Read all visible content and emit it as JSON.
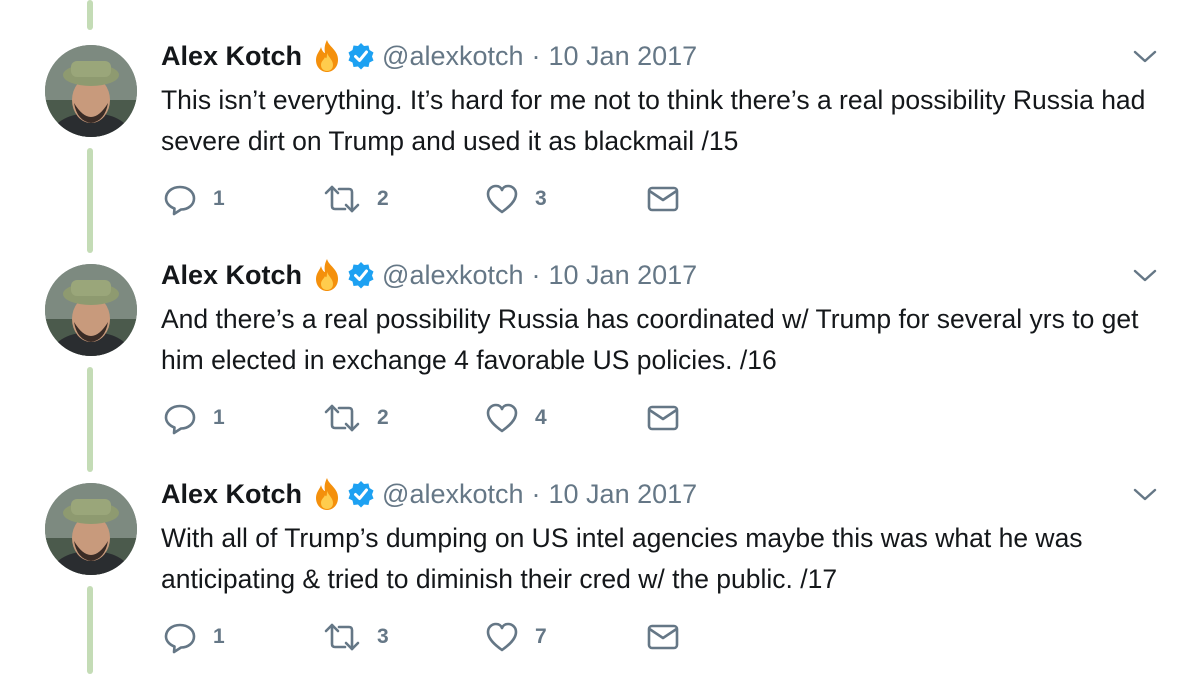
{
  "tweets": [
    {
      "name": "Alex Kotch",
      "handle": "@alexkotch",
      "separator": "·",
      "date": "10 Jan 2017",
      "text": "This isn’t everything. It’s hard for me not to think there’s a real possibility Russia had severe dirt on Trump and used it as blackmail /15",
      "replies": "1",
      "retweets": "2",
      "likes": "3"
    },
    {
      "name": "Alex Kotch",
      "handle": "@alexkotch",
      "separator": "·",
      "date": "10 Jan 2017",
      "text": "And there’s a real possibility Russia has coordinated w/ Trump for several yrs to get him elected in exchange 4 favorable US policies.  /16",
      "replies": "1",
      "retweets": "2",
      "likes": "4"
    },
    {
      "name": "Alex Kotch",
      "handle": "@alexkotch",
      "separator": "·",
      "date": "10 Jan 2017",
      "text": "With all of Trump’s dumping on US intel agencies maybe this was what he was anticipating & tried to diminish their cred w/ the public. /17",
      "replies": "1",
      "retweets": "3",
      "likes": "7"
    }
  ],
  "icons": {
    "name_emoji": "fire-icon",
    "badge": "verified-badge-icon",
    "menu": "chevron-down-icon",
    "reply": "reply-icon",
    "retweet": "retweet-icon",
    "like": "heart-icon",
    "message": "envelope-icon"
  },
  "colors": {
    "thread_line": "#c4dcb6",
    "verified": "#1da1f2",
    "secondary_text": "#657786",
    "primary_text": "#14171a"
  }
}
